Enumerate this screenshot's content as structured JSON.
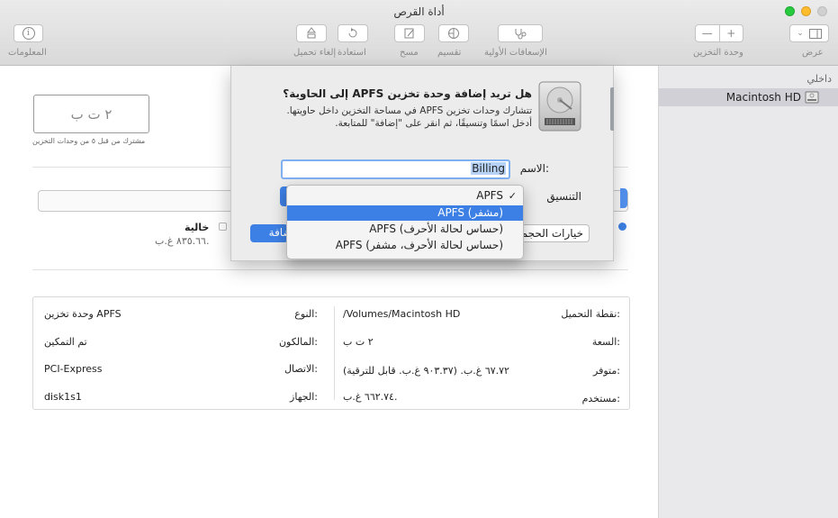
{
  "window": {
    "title": "أداة القرص"
  },
  "toolbar": {
    "info_label": "المعلومات",
    "firstaid_label": "الإسعافات الأولية",
    "partition_label": "تقسيم",
    "erase_label": "مسح",
    "restore_label": "استعادة",
    "unmount_label": "إلغاء تحميل",
    "volume_label": "وحدة التخزين",
    "view_label": "عرض",
    "add_glyph": "+",
    "remove_glyph": "—"
  },
  "sidebar": {
    "section": "داخلي",
    "items": [
      {
        "label": "Macintosh HD"
      }
    ]
  },
  "main": {
    "volume_size": "٢ ت ب",
    "shared_text": "مشترك من قبل ٥ من وحدات التخزين",
    "free_label": "خالية",
    "free_value": "٨٣٥.٦٦ غ.ب."
  },
  "info": {
    "mount_point_label": "نقطة التحميل:",
    "mount_point_value": "/Volumes/Macintosh HD",
    "type_label": "النوع:",
    "type_value": "وحدة تخزين APFS",
    "capacity_label": "السعة:",
    "capacity_value": "٢ ت ب",
    "owners_label": "المالكون:",
    "owners_value": "تم التمكين",
    "available_label": "متوفر:",
    "available_value": "٦٧.٧٢ غ.ب. (٩٠٣.٣٧ غ.ب. قابل للترقية)",
    "connection_label": "الاتصال:",
    "connection_value": "PCI-Express",
    "used_label": "مستخدم:",
    "used_value": "٦٦٢.٧٤ غ.ب.",
    "device_label": "الجهاز:",
    "device_value": "disk1s1"
  },
  "sheet": {
    "heading": "هل تريد إضافة وحدة تخزين APFS إلى الحاوية؟",
    "desc1": "تتشارك وحدات تخزين APFS في مساحة التخزين داخل حاويتها.",
    "desc2": "أدخل اسمًا وتنسيقًا، ثم انقر على \"إضافة\" للمتابعة.",
    "name_label": "الاسم:",
    "name_value": "Billing",
    "format_label": "التنسيق",
    "size_options_label": "خيارات الحجم",
    "add_label": "إضافة"
  },
  "format_menu": {
    "check": "✓",
    "options": [
      "APFS",
      "APFS (مشفر)",
      "APFS (حساس لحالة الأحرف)",
      "APFS (حساس لحالة الأحرف، مشفر)"
    ],
    "selected_index": 0,
    "highlighted_index": 1
  },
  "colors": {
    "accent": "#3d80e5",
    "traffic_green": "#27c93f",
    "traffic_yellow": "#ffbd2e",
    "traffic_disabled": "#d0d0d0"
  }
}
